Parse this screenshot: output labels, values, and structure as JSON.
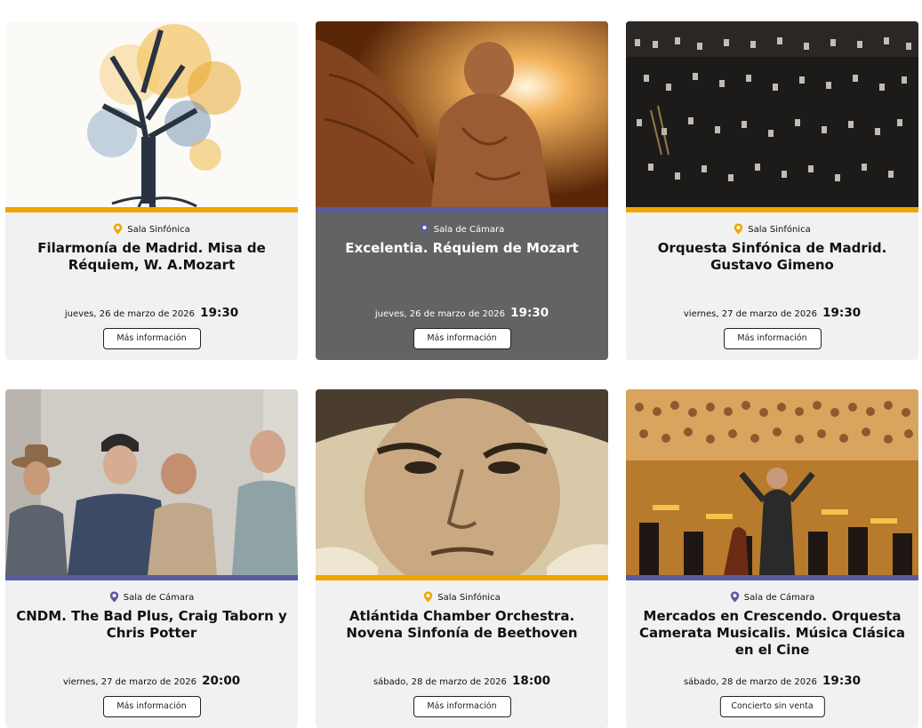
{
  "colors": {
    "sinfonica": "#f0a500",
    "camara": "#5a5aa0",
    "card_bg": "#f1f1f1",
    "card_dark_bg": "#636363"
  },
  "events": [
    {
      "venue": "Sala Sinfónica",
      "title": "Filarmonía de Madrid. Misa de Réquiem, W. A.Mozart",
      "date": "jueves, 26 de marzo de 2026",
      "time": "19:30",
      "button": "Más información",
      "image": "watercolor-tree"
    },
    {
      "venue": "Sala de Cámara",
      "title": "Excelentia. Réquiem de Mozart",
      "date": "jueves, 26 de marzo de 2026",
      "time": "19:30",
      "button": "Más información",
      "image": "angel-statue"
    },
    {
      "venue": "Sala Sinfónica",
      "title": "Orquesta Sinfónica de Madrid. Gustavo Gimeno",
      "date": "viernes, 27 de marzo de 2026",
      "time": "19:30",
      "button": "Más información",
      "image": "orchestra-hall"
    },
    {
      "venue": "Sala de Cámara",
      "title": "CNDM. The Bad Plus, Craig Taborn y Chris Potter",
      "date": "viernes, 27 de marzo de 2026",
      "time": "20:00",
      "button": "Más información",
      "image": "band-portrait"
    },
    {
      "venue": "Sala Sinfónica",
      "title": "Atlántida Chamber Orchestra. Novena Sinfonía de Beethoven",
      "date": "sábado, 28 de marzo de 2026",
      "time": "18:00",
      "button": "Más información",
      "image": "beethoven-portrait"
    },
    {
      "venue": "Sala de Cámara",
      "title": "Mercados en Crescendo. Orquesta Camerata Musicalis. Música Clásica en el Cine",
      "date": "sábado, 28 de marzo de 2026",
      "time": "19:30",
      "button": "Concierto sin venta",
      "image": "conductor-orchestra"
    }
  ]
}
